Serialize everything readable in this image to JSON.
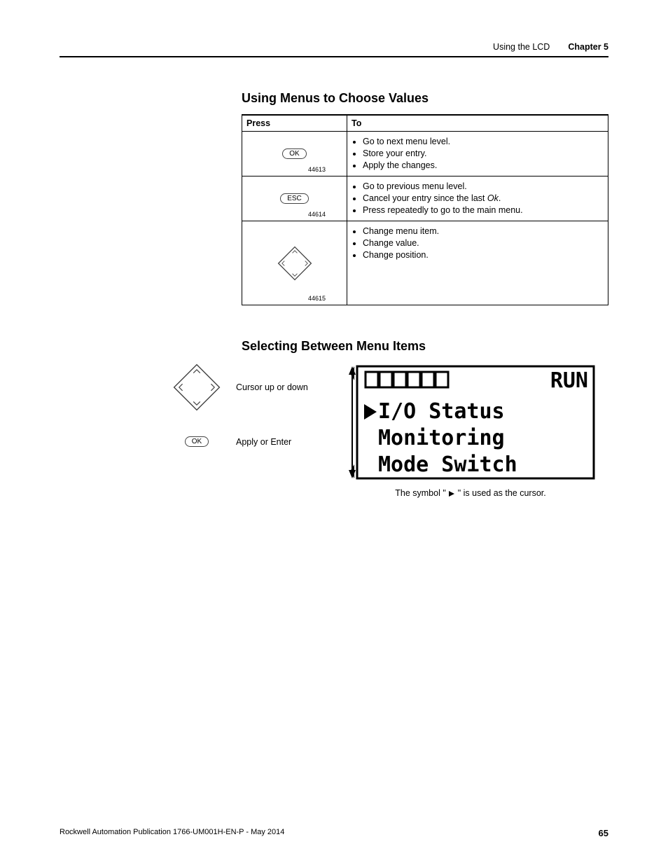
{
  "header": {
    "left": "Using the LCD",
    "right": "Chapter 5"
  },
  "section1": {
    "title": "Using Menus to Choose Values",
    "col_press": "Press",
    "col_to": "To",
    "rows": [
      {
        "btn": "OK",
        "figno": "44613",
        "to": [
          "Go to next menu level.",
          "Store your entry.",
          "Apply the changes."
        ]
      },
      {
        "btn": "ESC",
        "figno": "44614",
        "to": [
          "Go to previous menu level.",
          "Cancel your entry since the last Ok.",
          "Press repeatedly to go to the main menu."
        ]
      },
      {
        "btn": "DPAD",
        "figno": "44615",
        "to": [
          "Change menu item.",
          "Change value.",
          "Change position."
        ]
      }
    ]
  },
  "section2": {
    "title": "Selecting Between Menu Items",
    "items": [
      {
        "ctrl": "DPAD",
        "label": "Cursor up or down"
      },
      {
        "ctrl": "OK",
        "label": "Apply or Enter"
      }
    ],
    "lcd": {
      "status": "RUN",
      "lines": [
        "I/O Status",
        "Monitoring",
        "Mode Switch"
      ]
    },
    "caption_pre": "The symbol \" ",
    "caption_post": "\" is used as the cursor."
  },
  "footer": {
    "pub": "Rockwell Automation Publication 1766-UM001H-EN-P - May 2014",
    "page": "65"
  }
}
